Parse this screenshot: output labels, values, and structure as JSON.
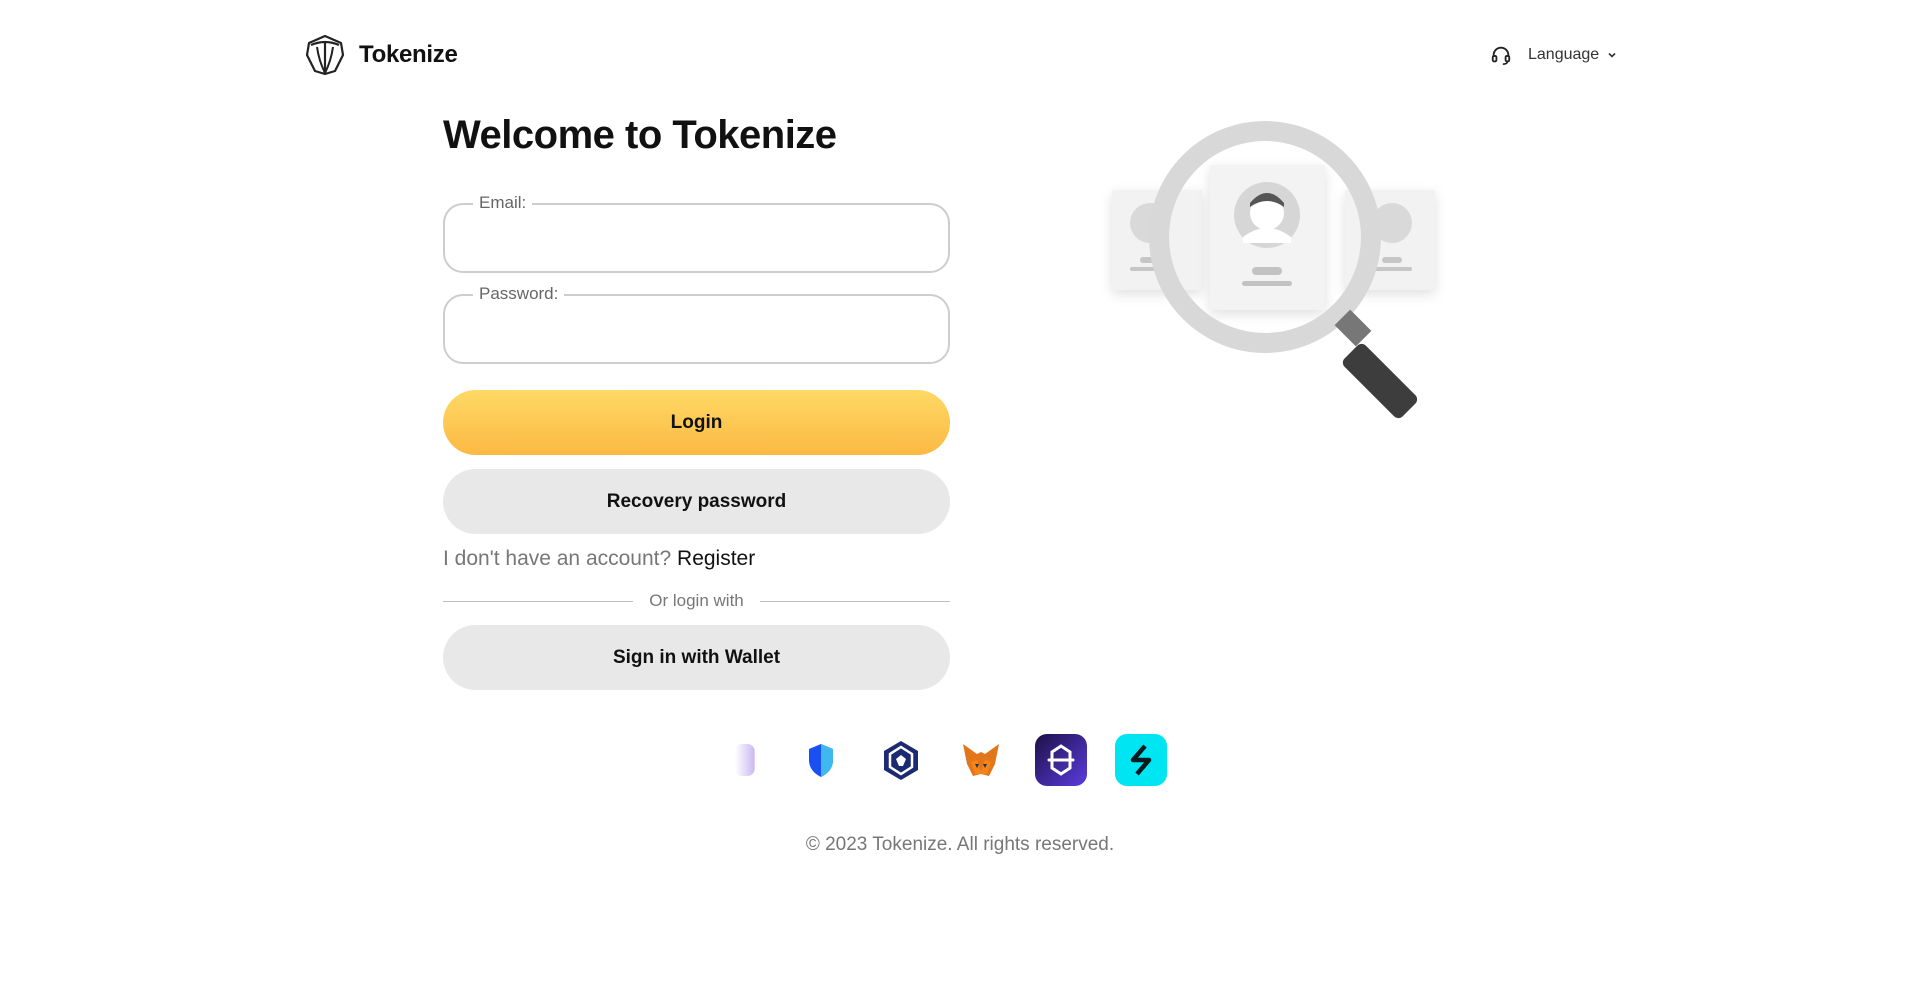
{
  "header": {
    "brand_name": "Tokenize",
    "language_label": "Language",
    "icons": {
      "logo": "tokenize-logo-icon",
      "support": "headset-icon",
      "chevron": "chevron-down-icon"
    }
  },
  "login": {
    "title": "Welcome to Tokenize",
    "email": {
      "label": "Email:",
      "value": "",
      "placeholder": ""
    },
    "password": {
      "label": "Password:",
      "value": "",
      "placeholder": ""
    },
    "login_button": "Login",
    "recovery_button": "Recovery password",
    "no_account_text": "I don't have an account?",
    "register_link": "Register",
    "divider_text": "Or login with",
    "wallet_button": "Sign in with Wallet"
  },
  "wallet_icons": [
    "wallet-icon-partial",
    "trust-wallet-shield-icon",
    "crypto-com-icon",
    "metamask-fox-icon",
    "exodus-icon",
    "bitget-icon"
  ],
  "colors": {
    "login_gradient_top": "#ffd966",
    "login_gradient_bottom": "#fbb942",
    "secondary_button": "#e8e8e8",
    "input_border": "#cdcdcd"
  },
  "footer": {
    "copyright": "© 2023 Tokenize. All rights reserved."
  }
}
